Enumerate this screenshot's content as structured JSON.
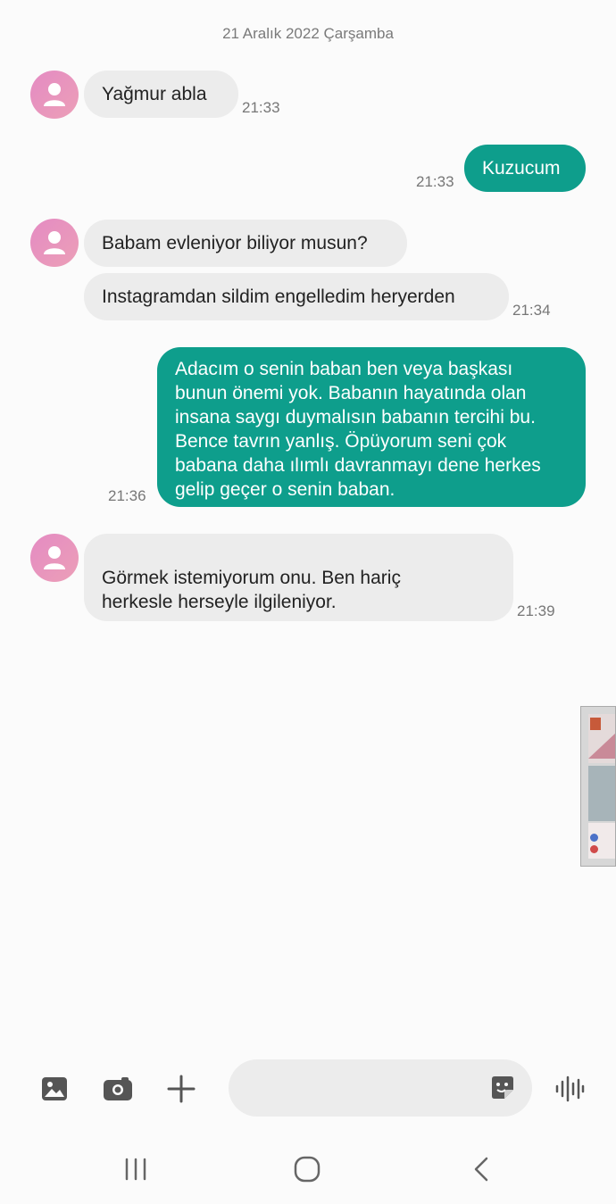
{
  "conversation": {
    "date_separator": "21 Aralık 2022 Çarşamba",
    "messages": [
      {
        "direction": "in",
        "lines": [
          "Yağmur abla"
        ],
        "time": "21:33"
      },
      {
        "direction": "out",
        "lines": [
          "Kuzucum"
        ],
        "time": "21:33"
      },
      {
        "direction": "in",
        "lines": [
          "Babam evleniyor biliyor musun?"
        ]
      },
      {
        "direction": "in",
        "lines": [
          "Instagramdan sildim engelledim heryerden"
        ],
        "time": "21:34"
      },
      {
        "direction": "out",
        "lines": [
          "Adacım o senin baban ben veya başkası",
          "bunun önemi yok. Babanın hayatında olan",
          "insana saygı duymalısın babanın tercihi bu.",
          "Bence tavrın yanlış. Öpüyorum seni çok",
          "babana daha ılımlı davranmayı dene herkes",
          "gelip geçer o senin baban."
        ],
        "time": "21:36"
      },
      {
        "direction": "in",
        "lines": [
          "Görmek istemiyorum onu. Ben hariç",
          "herkesle herseyle ilgileniyor."
        ],
        "time": "21:39"
      }
    ]
  },
  "composer": {
    "icons": [
      "image-icon",
      "camera-icon",
      "plus-icon",
      "sticker-icon",
      "voice-icon"
    ],
    "input_value": ""
  },
  "navbar": {
    "icons": [
      "recent-apps-icon",
      "home-icon",
      "back-icon"
    ]
  },
  "colors": {
    "outgoing_bubble": "#0e9e8c",
    "incoming_bubble": "#ececec",
    "avatar": "#e48bc3",
    "background": "#fbfbfb"
  }
}
